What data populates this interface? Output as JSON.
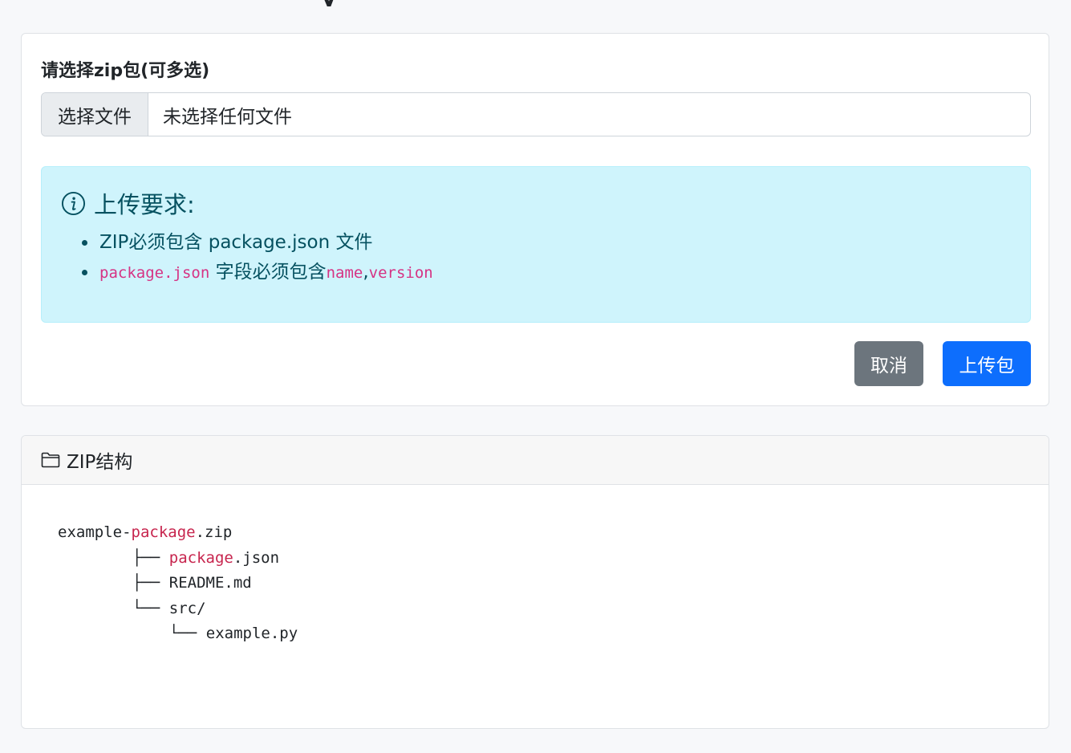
{
  "upload": {
    "label": "请选择zip包(可多选)",
    "file_button": "选择文件",
    "file_status": "未选择任何文件"
  },
  "requirements": {
    "title": "上传要求:",
    "item1": "ZIP必须包含 package.json 文件",
    "item2_code": "package.json",
    "item2_text": "字段必须包含",
    "item2_field1": "name",
    "item2_sep": ",",
    "item2_field2": "version"
  },
  "actions": {
    "cancel": "取消",
    "upload": "上传包"
  },
  "structure": {
    "header": "ZIP结构",
    "line1_prefix": "example-",
    "line1_kw": "package",
    "line1_suffix": ".zip",
    "line2_branch": "├── ",
    "line2_kw": "package",
    "line2_suffix": ".json",
    "line3": "├── README.md",
    "line4": "└── src/",
    "line5": "└── example.py"
  },
  "colors": {
    "info_bg": "#cff4fc",
    "info_text": "#055160",
    "primary": "#0d6efd",
    "secondary": "#6c757d",
    "code": "#d63384"
  },
  "icons": {
    "info": "info-circle-icon",
    "folder": "folder-icon"
  }
}
